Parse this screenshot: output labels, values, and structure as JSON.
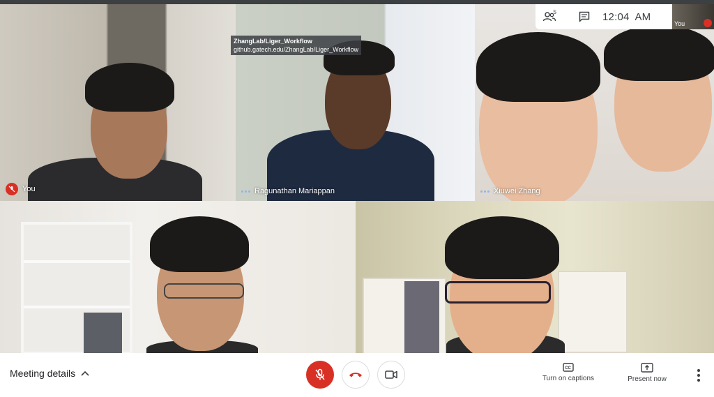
{
  "tooltip": {
    "line1": "ZhangLab/Liger_Workflow",
    "line2": "github.gatech.edu/ZhangLab/Liger_Workflow"
  },
  "top_panel": {
    "participants_icon": "people-icon",
    "participants_count": "5",
    "chat_icon": "chat-icon",
    "time": "12:04  AM",
    "self_label": "You"
  },
  "tiles": [
    {
      "name": "You",
      "mic_muted": true
    },
    {
      "name": "Ragunathan Mariappan",
      "speaking": true
    },
    {
      "name": "Xiuwei Zhang",
      "speaking": true
    },
    {
      "name": ""
    },
    {
      "name": ""
    }
  ],
  "bottom_bar": {
    "meeting_details": "Meeting details",
    "captions_label": "Turn on captions",
    "present_label": "Present now"
  },
  "colors": {
    "mute_red": "#d93025",
    "text_dark": "#3c4043",
    "speaking_blue": "#8ab4f8"
  }
}
